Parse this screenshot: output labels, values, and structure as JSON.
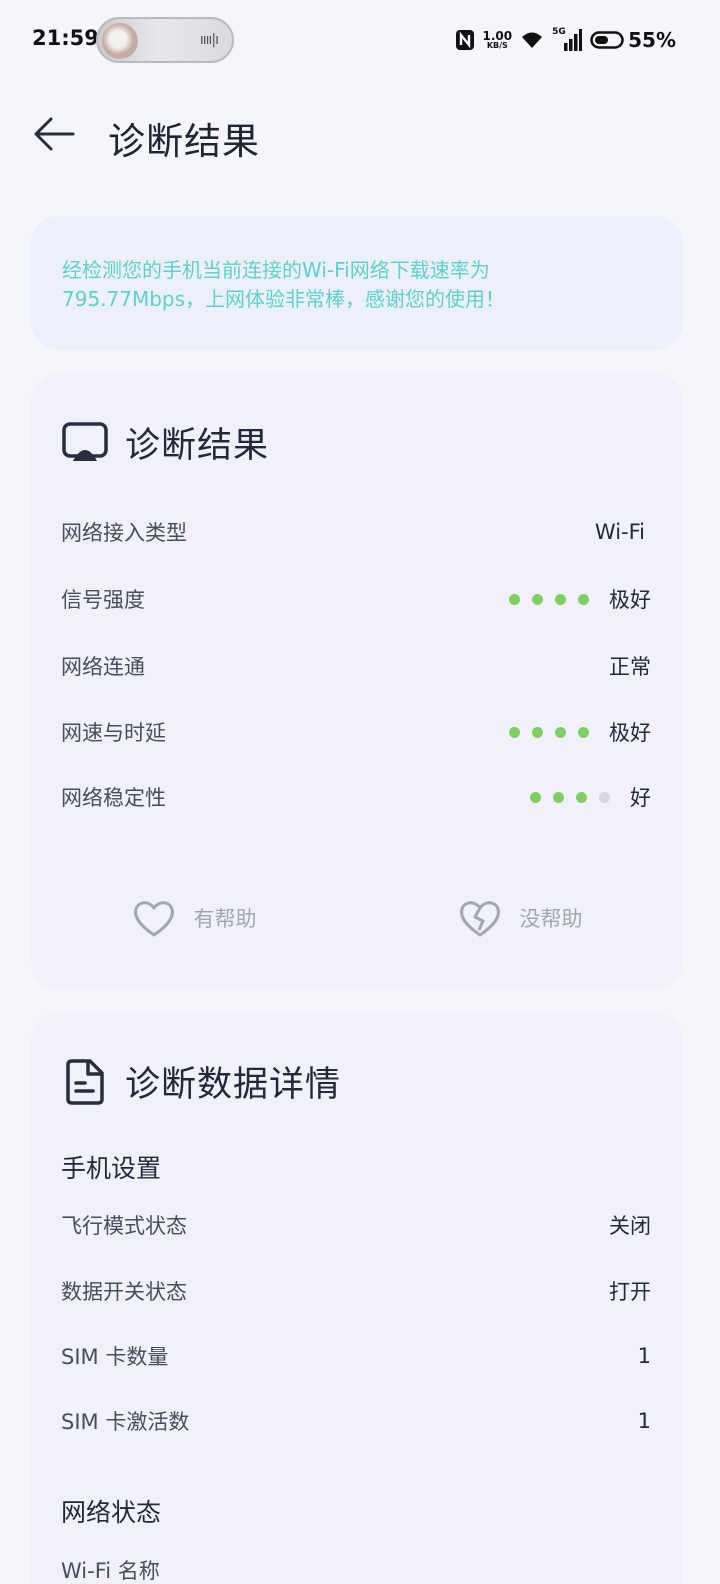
{
  "status_bar": {
    "time": "21:59",
    "net_speed_value": "1.00",
    "net_speed_unit": "KB/S",
    "network_type": "5G",
    "battery": "55%",
    "icons": [
      "nfc-icon",
      "wifi-icon",
      "signal-icon",
      "battery-icon"
    ]
  },
  "header": {
    "title": "诊断结果",
    "back_icon": "arrow-left-icon"
  },
  "notice": {
    "text": "经检测您的手机当前连接的Wi-Fi网络下载速率为795.77Mbps，上网体验非常棒，感谢您的使用！",
    "color": "#5fd0cb"
  },
  "result_card": {
    "title": "诊断结果",
    "icon": "network-diagnosis-icon",
    "rows": [
      {
        "label": "网络接入类型",
        "value": "Wi-Fi"
      },
      {
        "label": "信号强度",
        "value": "极好",
        "dots": 4,
        "dots_total": 4
      },
      {
        "label": "网络连通",
        "value": "正常"
      },
      {
        "label": "网速与时延",
        "value": "极好",
        "dots": 4,
        "dots_total": 4
      },
      {
        "label": "网络稳定性",
        "value": "好",
        "dots": 3,
        "dots_total": 4
      }
    ],
    "feedback": {
      "helpful": "有帮助",
      "not_helpful": "没帮助"
    },
    "accent_dot_color": "#7fcf64"
  },
  "details_card": {
    "title": "诊断数据详情",
    "icon": "document-icon",
    "sections": [
      {
        "title": "手机设置",
        "rows": [
          {
            "label": "飞行模式状态",
            "value": "关闭"
          },
          {
            "label": "数据开关状态",
            "value": "打开"
          },
          {
            "label": "SIM 卡数量",
            "value": "1"
          },
          {
            "label": "SIM 卡激活数",
            "value": "1"
          }
        ]
      },
      {
        "title": "网络状态",
        "rows": [
          {
            "label": "Wi-Fi 名称",
            "value": ""
          }
        ]
      }
    ]
  }
}
